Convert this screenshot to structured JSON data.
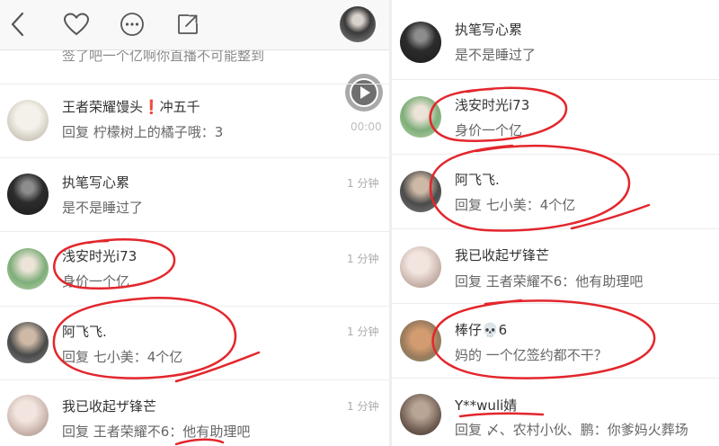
{
  "left_panel": {
    "nav": {
      "back_icon": "back-arrow-icon",
      "like_icon": "heart-icon",
      "more_icon": "more-icon",
      "share_icon": "share-icon"
    },
    "partial_comment": "签了吧一个亿啊你直播不可能整到",
    "video": {
      "icon": "play-icon",
      "time": "00:00"
    },
    "comments": [
      {
        "name": "王者荣耀馒头❗冲五千",
        "text": "回复 柠檬树上的橘子哦：3"
      },
      {
        "name": "执笔写心累",
        "text": "是不是睡过了",
        "time": "1 分钟"
      },
      {
        "name": "浅安时光i73",
        "text": "身价一个亿",
        "time": "1 分钟"
      },
      {
        "name": "阿飞飞.",
        "text": "回复 七小美：4个亿",
        "time": "1 分钟"
      },
      {
        "name": "我已收起ザ锋芒",
        "text": "回复 王者荣耀不6：他有助理吧",
        "time": "1 分钟"
      }
    ]
  },
  "right_panel": {
    "comments": [
      {
        "name": "执笔写心累",
        "text": "是不是睡过了"
      },
      {
        "name": "浅安时光i73",
        "text": "身价一个亿"
      },
      {
        "name": "阿飞飞.",
        "text": "回复 七小美：4个亿"
      },
      {
        "name": "我已收起ザ锋芒",
        "text": "回复 王者荣耀不6：他有助理吧"
      },
      {
        "name": "棒仔💀6",
        "text": "妈的 一个亿签约都不干？"
      },
      {
        "name": "Y**wuli婧",
        "text": "回复 〆、农村小伙、鹏：你爹妈火葬场"
      }
    ]
  },
  "colors": {
    "annotation": "#e3262c",
    "name_text": "#333333",
    "reply_text": "#666666",
    "timestamp": "#ababab"
  }
}
